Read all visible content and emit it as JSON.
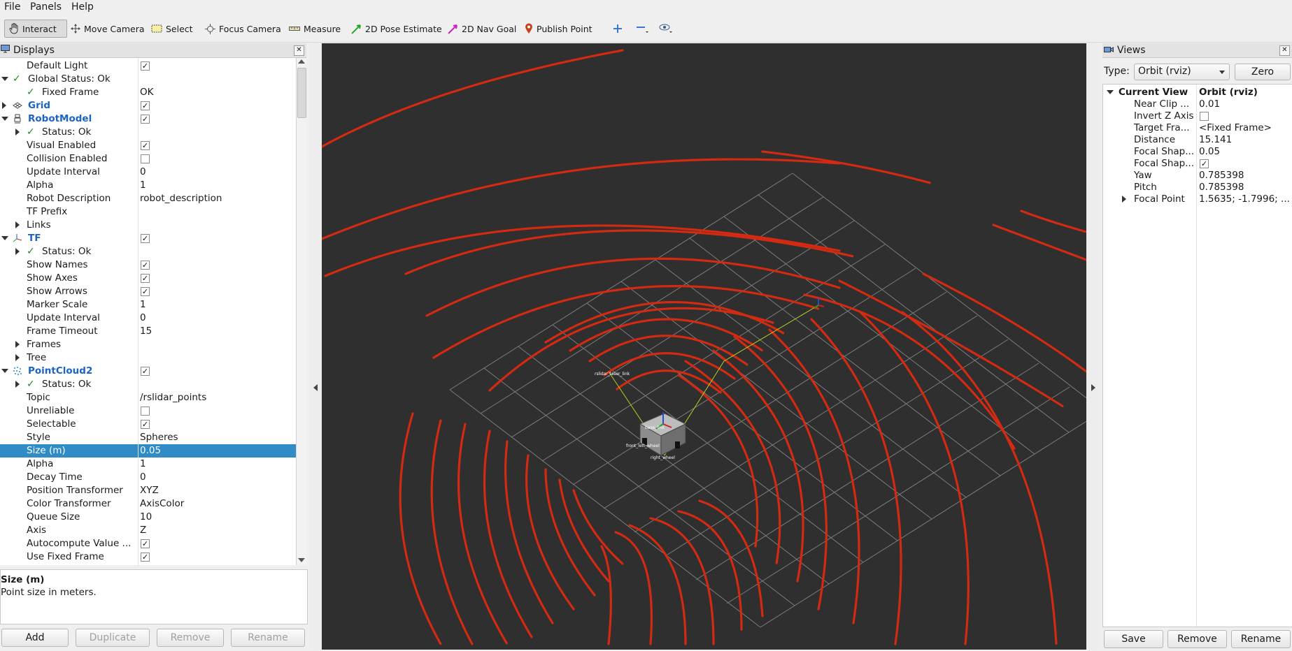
{
  "menu": [
    "File",
    "Panels",
    "Help"
  ],
  "toolbar": {
    "tools": [
      "Interact",
      "Move Camera",
      "Select",
      "Focus Camera",
      "Measure",
      "2D Pose Estimate",
      "2D Nav Goal",
      "Publish Point"
    ]
  },
  "displays": {
    "title": "Displays",
    "rows": [
      {
        "name": "Default Light",
        "value": ""
      },
      {
        "name": "Global Status: Ok",
        "value": ""
      },
      {
        "name": "Fixed Frame",
        "value": "OK"
      },
      {
        "name": "Grid",
        "value": ""
      },
      {
        "name": "RobotModel",
        "value": ""
      },
      {
        "name": "Status: Ok",
        "value": ""
      },
      {
        "name": "Visual Enabled",
        "value": ""
      },
      {
        "name": "Collision Enabled",
        "value": ""
      },
      {
        "name": "Update Interval",
        "value": "0"
      },
      {
        "name": "Alpha",
        "value": "1"
      },
      {
        "name": "Robot Description",
        "value": "robot_description"
      },
      {
        "name": "TF Prefix",
        "value": ""
      },
      {
        "name": "Links",
        "value": ""
      },
      {
        "name": "TF",
        "value": ""
      },
      {
        "name": "Status: Ok",
        "value": ""
      },
      {
        "name": "Show Names",
        "value": ""
      },
      {
        "name": "Show Axes",
        "value": ""
      },
      {
        "name": "Show Arrows",
        "value": ""
      },
      {
        "name": "Marker Scale",
        "value": "1"
      },
      {
        "name": "Update Interval",
        "value": "0"
      },
      {
        "name": "Frame Timeout",
        "value": "15"
      },
      {
        "name": "Frames",
        "value": ""
      },
      {
        "name": "Tree",
        "value": ""
      },
      {
        "name": "PointCloud2",
        "value": ""
      },
      {
        "name": "Status: Ok",
        "value": ""
      },
      {
        "name": "Topic",
        "value": "/rslidar_points"
      },
      {
        "name": "Unreliable",
        "value": ""
      },
      {
        "name": "Selectable",
        "value": ""
      },
      {
        "name": "Style",
        "value": "Spheres"
      },
      {
        "name": "Size (m)",
        "value": "0.05"
      },
      {
        "name": "Alpha",
        "value": "1"
      },
      {
        "name": "Decay Time",
        "value": "0"
      },
      {
        "name": "Position Transformer",
        "value": "XYZ"
      },
      {
        "name": "Color Transformer",
        "value": "AxisColor"
      },
      {
        "name": "Queue Size",
        "value": "10"
      },
      {
        "name": "Axis",
        "value": "Z"
      },
      {
        "name": "Autocompute Value ...",
        "value": ""
      },
      {
        "name": "Use Fixed Frame",
        "value": ""
      }
    ],
    "checkboxes": {
      "default_light": true,
      "grid": true,
      "robot_model": true,
      "visual_enabled": true,
      "collision_enabled": false,
      "tf": true,
      "show_names": true,
      "show_axes": true,
      "show_arrows": true,
      "pointcloud2": true,
      "unreliable": false,
      "selectable": true,
      "autocompute": true,
      "use_fixed_frame": true
    },
    "selected_row": "Size (m)"
  },
  "description": {
    "title": "Size (m)",
    "text": "Point size in meters."
  },
  "displays_buttons": {
    "add": "Add",
    "duplicate": "Duplicate",
    "remove": "Remove",
    "rename": "Rename"
  },
  "views": {
    "title": "Views",
    "type_label": "Type:",
    "type_value": "Orbit (rviz)",
    "zero_label": "Zero",
    "current_view": {
      "name": "Current View",
      "value": "Orbit (rviz)"
    },
    "rows": [
      {
        "name": "Near Clip ...",
        "value": "0.01"
      },
      {
        "name": "Invert Z Axis",
        "value": ""
      },
      {
        "name": "Target Fra...",
        "value": "<Fixed Frame>"
      },
      {
        "name": "Distance",
        "value": "15.141"
      },
      {
        "name": "Focal Shap...",
        "value": "0.05"
      },
      {
        "name": "Focal Shap...",
        "value": ""
      },
      {
        "name": "Yaw",
        "value": "0.785398"
      },
      {
        "name": "Pitch",
        "value": "0.785398"
      },
      {
        "name": "Focal Point",
        "value": "1.5635; -1.7996; ..."
      }
    ],
    "invert_z": false,
    "focal_shape_fixed": true,
    "buttons": {
      "save": "Save",
      "remove": "Remove",
      "rename": "Rename"
    }
  },
  "viewport": {
    "robot_labels": [
      "rslidar_laser_link",
      "base_link",
      "front_left_wheel",
      "right_wheel"
    ],
    "pointcloud_color": "#d42a12",
    "grid_color": "#8a8a8a",
    "background": "#2f2f2f"
  },
  "colors": {
    "selection": "#308cc6",
    "link_blue": "#1c64c4",
    "status_green": "#1f8a1f"
  }
}
